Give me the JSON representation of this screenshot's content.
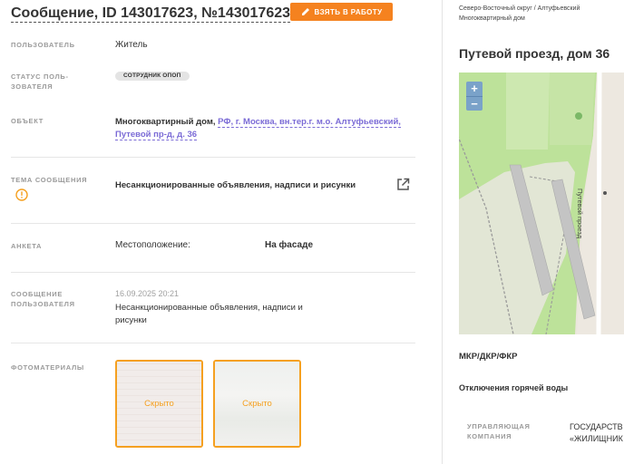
{
  "header": {
    "title": "Сообщение, ID 143017623, №143017623",
    "take_button": "ВЗЯТЬ В РАБОТУ"
  },
  "rows": {
    "user": {
      "label": "ПОЛЬЗОВАТЕЛЬ",
      "value": "Житель"
    },
    "user_status": {
      "label_line1": "СТАТУС ПОЛЬ-",
      "label_line2": "ЗОВАТЕЛЯ",
      "badge": "СОТРУДНИК ОПОП"
    },
    "object": {
      "label": "ОБЪЕКТ",
      "value_prefix": "Многоквартирный дом, ",
      "link_line1": "РФ, г. Москва, вн.тер.г. м.о. Алтуфьевский,",
      "link_line2": "Путевой пр-д, д. 36"
    },
    "topic": {
      "label": "ТЕМА СООБЩЕНИЯ",
      "value": "Несанкционированные объявления, надписи и рисунки"
    },
    "survey": {
      "label": "АНКЕТА",
      "field": "Местоположение:",
      "value": "На фасаде"
    },
    "user_message": {
      "label_line1": "СООБЩЕНИЕ",
      "label_line2": "ПОЛЬЗОВАТЕЛЯ",
      "date": "16.09.2025 20:21",
      "text_line1": "Несанкционированные объявления, надписи и",
      "text_line2": "рисунки"
    },
    "photos": {
      "label": "ФОТОМАТЕРИАЛЫ",
      "items": [
        "Скрыто",
        "Скрыто"
      ]
    }
  },
  "right": {
    "breadcrumb_line1": "Северо-Восточный округ / Алтуфьевский",
    "breadcrumb_line2": "Многоквартирный дом",
    "title": "Путевой проезд, дом 36",
    "map": {
      "zoom_in": "+",
      "zoom_out": "−",
      "street_label": "Путевой проезд"
    },
    "mkr": "МКР/ДКР/ФКР",
    "hot_water": "Отключения горячей воды",
    "management": {
      "label_line1": "УПРАВЛЯЮЩАЯ",
      "label_line2": "КОМПАНИЯ",
      "value_line1": "ГОСУДАРСТВ",
      "value_line2": "«ЖИЛИЩНИК"
    }
  },
  "colors": {
    "accent": "#f5821f",
    "link": "#7b6bd6",
    "photo_border": "#f5a020",
    "warning": "#f5a020"
  }
}
